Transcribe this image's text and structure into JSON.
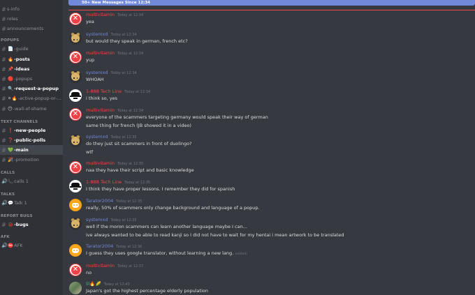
{
  "sidebar": {
    "channels_top": [
      {
        "label": "s-info",
        "emoji": "",
        "state": "normal"
      },
      {
        "label": "roles",
        "emoji": "",
        "state": "normal"
      },
      {
        "label": "announcements",
        "emoji": "",
        "state": "normal"
      }
    ],
    "categories": {
      "popups": "POPUPS",
      "text": "TEXT CHANNELS",
      "calls": "CALLS",
      "talks": "TALKS",
      "report": "REPORT BUGS",
      "afk": "AFK"
    },
    "popups_channels": [
      {
        "label": "-guide",
        "emoji": "📄",
        "state": "normal"
      },
      {
        "label": "-posts",
        "emoji": "🔥",
        "state": "unread"
      },
      {
        "label": "-ideas",
        "emoji": "📌",
        "state": "unread"
      },
      {
        "label": "-popups",
        "emoji": "🔴",
        "state": "normal"
      },
      {
        "label": "-request-a-popup",
        "emoji": "🔍",
        "state": "unread"
      },
      {
        "label": "-active-popup-or-n...",
        "emoji": "⚪🔥",
        "state": "normal"
      },
      {
        "label": "-wall-of-shame",
        "emoji": "😶",
        "state": "normal"
      }
    ],
    "text_channels": [
      {
        "label": "-new-people",
        "emoji": "❗",
        "state": "unread"
      },
      {
        "label": "-public-polls",
        "emoji": "❓",
        "state": "unread"
      },
      {
        "label": "-main",
        "emoji": "💚",
        "state": "active"
      },
      {
        "label": "-promotion",
        "emoji": "🎉",
        "state": "normal"
      }
    ],
    "calls_channels": [
      {
        "label": "calls 1",
        "emoji": "📞"
      }
    ],
    "talks_channels": [
      {
        "label": "Talk 1",
        "emoji": "💬"
      }
    ],
    "report_channels": [
      {
        "label": "-bugs",
        "emoji": "🐞",
        "state": "unread"
      }
    ],
    "afk_channels": [
      {
        "label": "AFK",
        "emoji": "⛔"
      }
    ]
  },
  "banner": {
    "text": "50+ New Messages Since 12:34"
  },
  "messages": [
    {
      "avatar": "x",
      "author": "multivitamin",
      "color": "#f04747",
      "time": "Today at 12:34",
      "lines": [
        "yea"
      ]
    },
    {
      "avatar": "doge",
      "author": "systemxd",
      "color": "#7289da",
      "time": "Today at 12:34",
      "lines": [
        "but would they speak in german, french etc?"
      ]
    },
    {
      "avatar": "x",
      "author": "multivitamin",
      "color": "#f04747",
      "time": "Today at 12:34",
      "lines": [
        "yup"
      ]
    },
    {
      "avatar": "doge",
      "author": "systemxd",
      "color": "#7289da",
      "time": "Today at 12:34",
      "lines": [
        "WHOAH"
      ]
    },
    {
      "avatar": "tech",
      "author": "1-888 Tech Line",
      "color": "#f04747",
      "time": "Today at 12:34",
      "lines": [
        "i think so, yes"
      ]
    },
    {
      "avatar": "x",
      "author": "multivitamin",
      "color": "#f04747",
      "time": "Today at 12:34",
      "lines": [
        "everyone of the scammers targeting germany would speak their way of german",
        "same thing for french (JB showed it in a video)"
      ]
    },
    {
      "avatar": "doge",
      "author": "systemxd",
      "color": "#7289da",
      "time": "Today at 12:35",
      "lines": [
        "do they just sit scammers in front of duolingo?",
        "wtf"
      ]
    },
    {
      "avatar": "x",
      "author": "multivitamin",
      "color": "#f04747",
      "time": "Today at 12:35",
      "lines": [
        "naa they have their script and basic knowledge"
      ]
    },
    {
      "avatar": "tech",
      "author": "1-888 Tech Line",
      "color": "#f04747",
      "time": "Today at 12:35",
      "lines": [
        "I think they have proper lessons. I remember they did for spanish"
      ]
    },
    {
      "avatar": "disc",
      "author": "Tarator2004",
      "color": "#7289da",
      "time": "Today at 12:35",
      "lines": [
        "really, 50% of scammers only change background and language of a popup."
      ]
    },
    {
      "avatar": "doge",
      "author": "systemxd",
      "color": "#7289da",
      "time": "Today at 12:35",
      "lines": [
        "well if the moron scammers can learn another language maybe I can...",
        "ive always wanted to be able to read kanji so I did not have to wait for my hentai i mean artwork to be translated"
      ]
    },
    {
      "avatar": "disc",
      "author": "Tarator2004",
      "color": "#7289da",
      "time": "Today at 12:36",
      "lines": [
        "I guess they uses google translator, without learning a new lang."
      ],
      "edited": "(edited)"
    },
    {
      "avatar": "x",
      "author": "multivitamin",
      "color": "#f04747",
      "time": "Today at 12:37",
      "lines": [
        "no"
      ]
    },
    {
      "avatar": "photo",
      "author": "lil🔥🌽",
      "color": "#43b581",
      "time": "Today at 12:43",
      "lines": [
        "Japan's got the highest percentage elderly population"
      ]
    }
  ]
}
